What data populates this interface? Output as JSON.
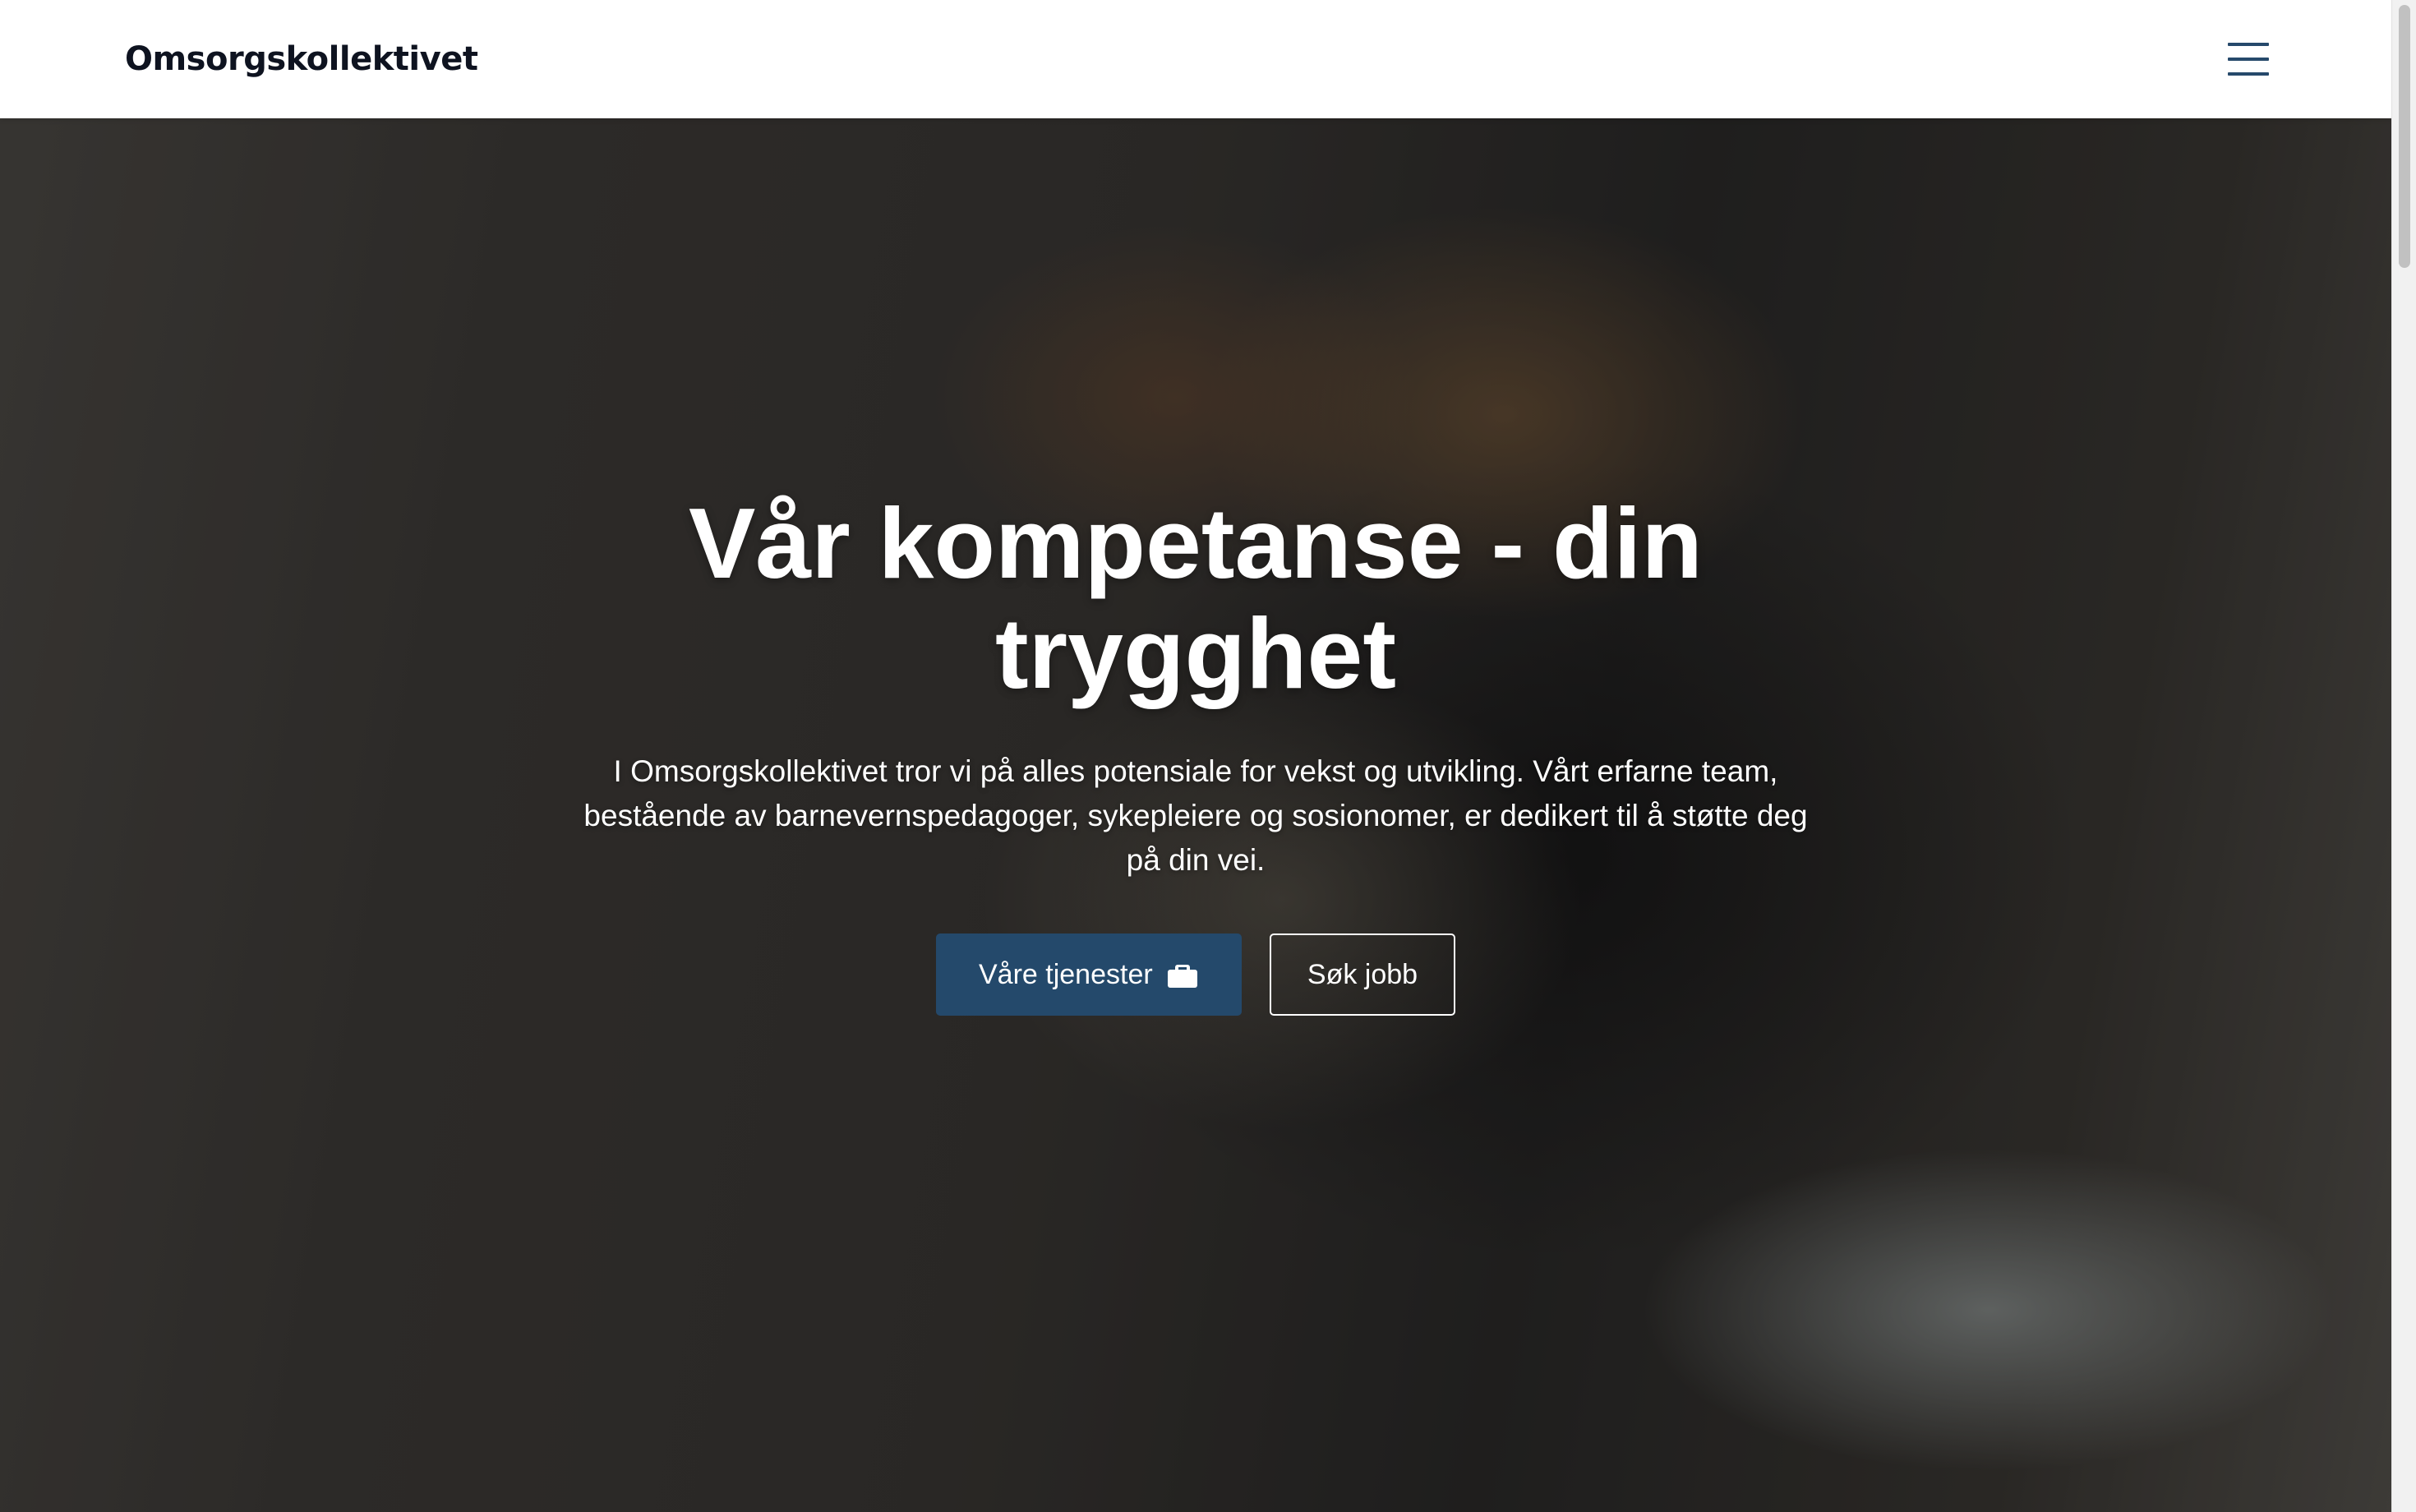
{
  "header": {
    "logo": "Omsorgskollektivet",
    "menu_icon": "hamburger-menu-icon"
  },
  "hero": {
    "title": "Vår kompetanse - din trygghet",
    "text": "I Omsorgskollektivet tror vi på alles potensiale for vekst og utvikling. Vårt erfarne team, bestående av barnevernspedagoger, sykepleiere og sosionomer, er dedikert til å støtte deg på din vei.",
    "primary_button": {
      "label": "Våre tjenester",
      "icon": "briefcase-icon"
    },
    "secondary_button": {
      "label": "Søk jobb"
    }
  },
  "colors": {
    "brand": "#24496b",
    "logo_text": "#0e1320",
    "hero_text": "#ffffff"
  }
}
